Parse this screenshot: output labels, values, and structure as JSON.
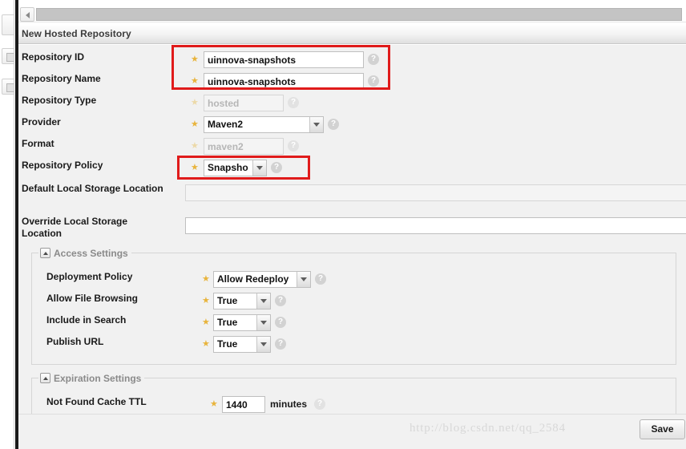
{
  "window": {
    "scrollbar": {
      "left_arrow_icon": "chevron-left-icon"
    }
  },
  "panel": {
    "title": "New Hosted Repository"
  },
  "form": {
    "rows": [
      {
        "label": "Repository ID",
        "control": "text",
        "value": "uinnova-snapshots",
        "required": true,
        "disabled": false,
        "help_icon": "help-circle-icon"
      },
      {
        "label": "Repository Name",
        "control": "text",
        "value": "uinnova-snapshots",
        "required": true,
        "disabled": false,
        "help_icon": "help-circle-icon"
      },
      {
        "label": "Repository Type",
        "control": "text",
        "value": "hosted",
        "required": true,
        "disabled": true,
        "help_icon": "help-circle-icon"
      },
      {
        "label": "Provider",
        "control": "select",
        "value": "Maven2",
        "required": true,
        "disabled": false,
        "help_icon": "help-circle-icon"
      },
      {
        "label": "Format",
        "control": "text",
        "value": "maven2",
        "required": true,
        "disabled": true,
        "help_icon": "help-circle-icon"
      },
      {
        "label": "Repository Policy",
        "control": "select",
        "value": "Snapsho",
        "required": true,
        "disabled": false,
        "help_icon": "help-circle-icon"
      },
      {
        "label": "Default Local Storage Location",
        "control": "text-wide",
        "value": "",
        "required": false,
        "disabled": true,
        "help_icon": ""
      },
      {
        "label": "Override Local Storage Location",
        "control": "text-wide",
        "value": "",
        "required": false,
        "disabled": false,
        "help_icon": ""
      }
    ]
  },
  "access_settings": {
    "legend": "Access Settings",
    "toggle_icon": "collapse-triangle-icon",
    "rows": [
      {
        "label": "Deployment Policy",
        "control": "select",
        "value": "Allow Redeploy",
        "required": true,
        "help_icon": "help-circle-icon"
      },
      {
        "label": "Allow File Browsing",
        "control": "select",
        "value": "True",
        "required": true,
        "help_icon": "help-circle-icon"
      },
      {
        "label": "Include in Search",
        "control": "select",
        "value": "True",
        "required": true,
        "help_icon": "help-circle-icon"
      },
      {
        "label": "Publish URL",
        "control": "select",
        "value": "True",
        "required": true,
        "help_icon": "help-circle-icon"
      }
    ]
  },
  "expiration_settings": {
    "legend": "Expiration Settings",
    "toggle_icon": "collapse-triangle-icon",
    "rows": [
      {
        "label": "Not Found Cache TTL",
        "control": "text",
        "value": "1440",
        "unit": "minutes",
        "required": true,
        "help_icon": "help-circle-icon"
      }
    ]
  },
  "footer": {
    "save_label": "Save"
  },
  "watermark": {
    "text": "http://blog.csdn.net/qq_2584"
  },
  "colors": {
    "annotation": "#e01b1b",
    "required_star": "#e8b43c",
    "panel_bg": "#f1f1f1"
  }
}
